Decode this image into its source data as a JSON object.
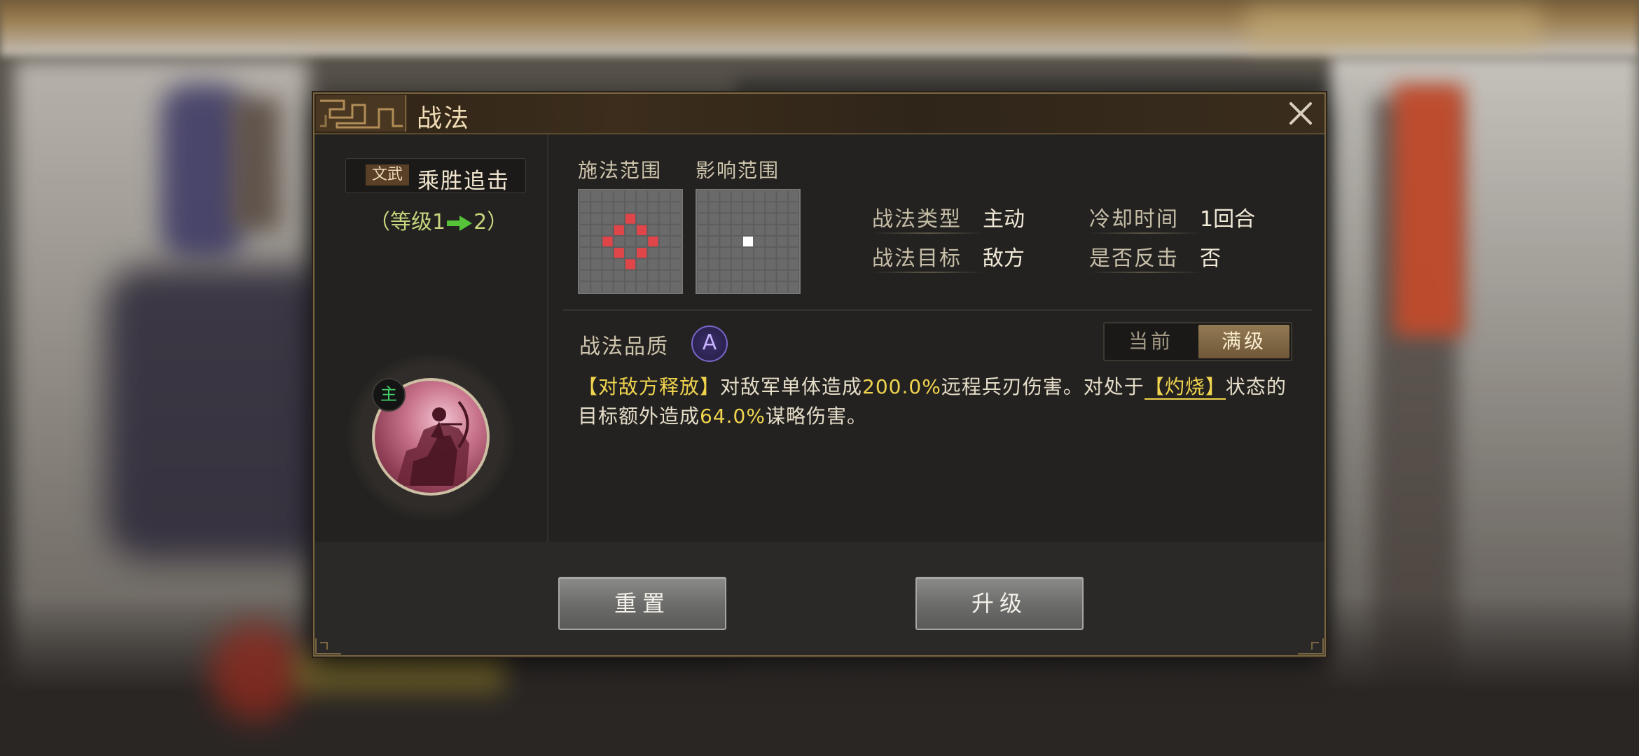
{
  "dialog": {
    "title": "战法",
    "skill": {
      "type_tag": "文武",
      "name": "乘胜追击",
      "level_prefix": "（等级1",
      "level_suffix": "2）",
      "main_badge": "主"
    },
    "range": {
      "cast_label": "施法范围",
      "effect_label": "影响范围",
      "cast_grid_highlight_color": "#e0454a",
      "effect_grid_highlight_color": "#ffffff"
    },
    "attributes": {
      "type_label": "战法类型",
      "type_value": "主动",
      "cooldown_label": "冷却时间",
      "cooldown_value": "1回合",
      "target_label": "战法目标",
      "target_value": "敌方",
      "counter_label": "是否反击",
      "counter_value": "否"
    },
    "quality": {
      "label": "战法品质",
      "grade": "A"
    },
    "toggle": {
      "current": "当前",
      "max": "满级"
    },
    "description": {
      "p1": "【对敌方释放】",
      "p2": "对敌军单体造成",
      "p3": "200.0%",
      "p4": "远程兵刃伤害。对处于",
      "p5": "【灼烧】",
      "p6": "状态的目标额外造成",
      "p7": "64.0%",
      "p8": "谋略伤害。"
    },
    "buttons": {
      "reset": "重置",
      "upgrade": "升级"
    }
  }
}
